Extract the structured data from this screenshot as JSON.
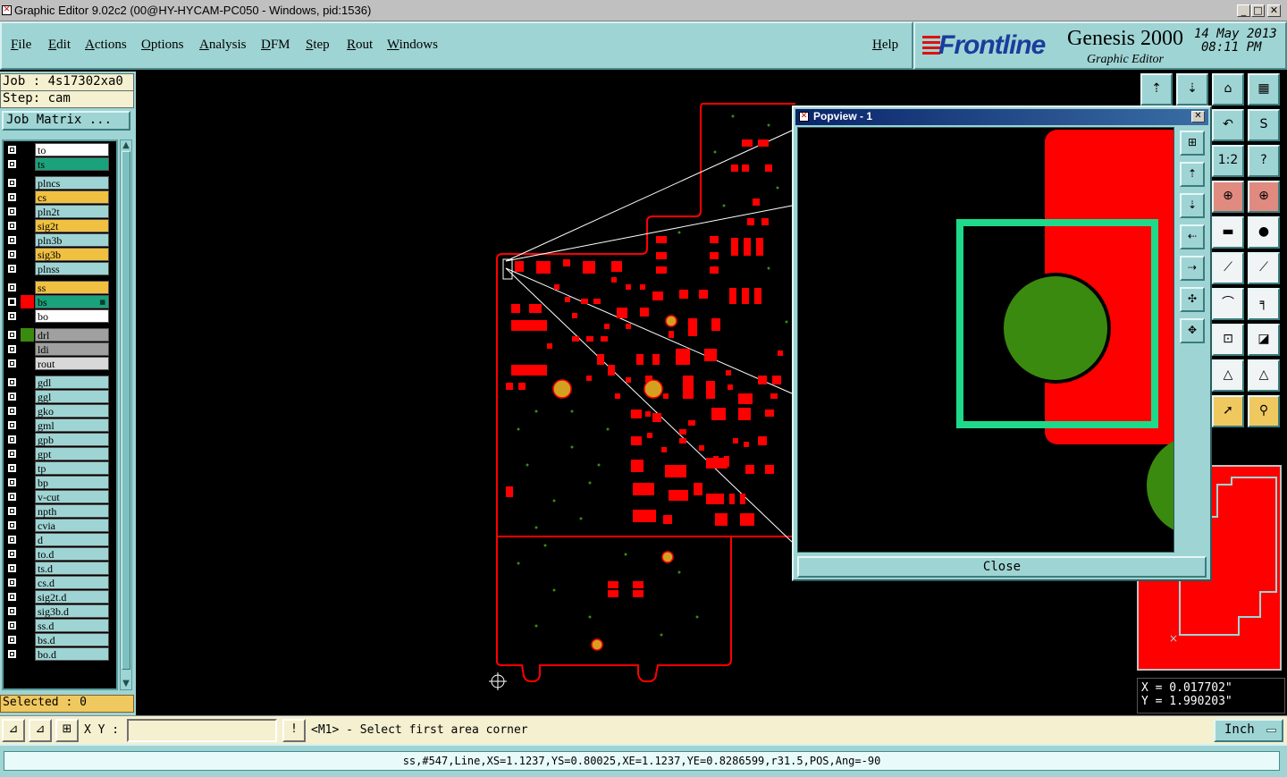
{
  "window": {
    "title": "Graphic Editor 9.02c2 (00@HY-HYCAM-PC050 - Windows, pid:1536)",
    "buttons": [
      "_",
      "□",
      "✕"
    ]
  },
  "menu": {
    "items": [
      "File",
      "Edit",
      "Actions",
      "Options",
      "Analysis",
      "DFM",
      "Step",
      "Rout",
      "Windows"
    ],
    "help": "Help"
  },
  "brand": {
    "logo": "Frontline",
    "product": "Genesis 2000",
    "subtitle": "Graphic Editor",
    "date": "14 May 2013",
    "time": "08:11 PM"
  },
  "left": {
    "job": "Job : 4s17302xa0",
    "step": "Step: cam",
    "job_matrix": "Job Matrix ...",
    "selected": "Selected : 0",
    "layers": [
      {
        "name": "to",
        "color": "#ffffff",
        "swatch": "#000000"
      },
      {
        "name": "ts",
        "color": "#1aa27c",
        "swatch": "#000000"
      },
      {
        "name": "plncs",
        "color": "#9fd4d4",
        "swatch": "#000000"
      },
      {
        "name": "cs",
        "color": "#f0c040",
        "swatch": "#000000"
      },
      {
        "name": "pln2t",
        "color": "#9fd4d4",
        "swatch": "#000000"
      },
      {
        "name": "sig2t",
        "color": "#f0c040",
        "swatch": "#000000"
      },
      {
        "name": "pln3b",
        "color": "#9fd4d4",
        "swatch": "#000000"
      },
      {
        "name": "sig3b",
        "color": "#f0c040",
        "swatch": "#000000"
      },
      {
        "name": "plnss",
        "color": "#9fd4d4",
        "swatch": "#000000"
      },
      {
        "name": "ss",
        "color": "#f0c040",
        "swatch": "#000000"
      },
      {
        "name": "bs",
        "color": "#1aa27c",
        "swatch": "#ff0000",
        "active": true
      },
      {
        "name": "bo",
        "color": "#ffffff",
        "swatch": "#000000"
      },
      {
        "name": "drl",
        "color": "#a0a0a0",
        "swatch": "#3a8a10"
      },
      {
        "name": "ldi",
        "color": "#a0a0a0",
        "swatch": "#000000"
      },
      {
        "name": "rout",
        "color": "#d8d8d8",
        "swatch": "#000000"
      },
      {
        "name": "gdl",
        "color": "#9fd4d4",
        "swatch": "#000000"
      },
      {
        "name": "ggl",
        "color": "#9fd4d4",
        "swatch": "#000000"
      },
      {
        "name": "gko",
        "color": "#9fd4d4",
        "swatch": "#000000"
      },
      {
        "name": "gml",
        "color": "#9fd4d4",
        "swatch": "#000000"
      },
      {
        "name": "gpb",
        "color": "#9fd4d4",
        "swatch": "#000000"
      },
      {
        "name": "gpt",
        "color": "#9fd4d4",
        "swatch": "#000000"
      },
      {
        "name": "tp",
        "color": "#9fd4d4",
        "swatch": "#000000"
      },
      {
        "name": "bp",
        "color": "#9fd4d4",
        "swatch": "#000000"
      },
      {
        "name": "v-cut",
        "color": "#9fd4d4",
        "swatch": "#000000"
      },
      {
        "name": "npth",
        "color": "#9fd4d4",
        "swatch": "#000000"
      },
      {
        "name": "cvia",
        "color": "#9fd4d4",
        "swatch": "#000000"
      },
      {
        "name": "d",
        "color": "#9fd4d4",
        "swatch": "#000000"
      },
      {
        "name": "to.d",
        "color": "#9fd4d4",
        "swatch": "#000000"
      },
      {
        "name": "ts.d",
        "color": "#9fd4d4",
        "swatch": "#000000"
      },
      {
        "name": "cs.d",
        "color": "#9fd4d4",
        "swatch": "#000000"
      },
      {
        "name": "sig2t.d",
        "color": "#9fd4d4",
        "swatch": "#000000"
      },
      {
        "name": "sig3b.d",
        "color": "#9fd4d4",
        "swatch": "#000000"
      },
      {
        "name": "ss.d",
        "color": "#9fd4d4",
        "swatch": "#000000"
      },
      {
        "name": "bs.d",
        "color": "#9fd4d4",
        "swatch": "#000000"
      },
      {
        "name": "bo.d",
        "color": "#9fd4d4",
        "swatch": "#000000"
      }
    ]
  },
  "popview": {
    "title": "Popview - 1",
    "close": "Close"
  },
  "coords": {
    "x": "X = 0.017702\"",
    "y": "Y = 1.990203\""
  },
  "cmd": {
    "xy_label": "X Y :",
    "xy_value": "",
    "prompt": "<M1> - Select first area corner",
    "unit": "Inch"
  },
  "status": "ss,#547,Line,XS=1.1237,YS=0.80025,XE=1.1237,YE=0.8286599,r31.5,POS,Ang=-90",
  "colors": {
    "panel": "#9fd4d4",
    "copper": "#ff0000",
    "highlight": "#1aa27c",
    "drill": "#3a8a10",
    "pad_yellow": "#d4a020"
  }
}
